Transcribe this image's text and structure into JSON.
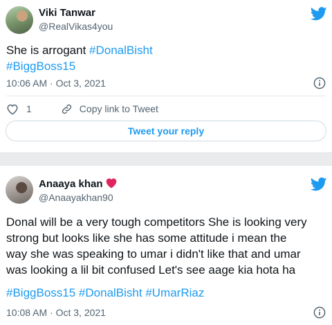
{
  "tweet1": {
    "name": "Viki Tanwar",
    "handle": "@RealVikas4you",
    "text": "She is arrogant ",
    "hashtags": [
      "#DonalBisht",
      "#BiggBoss15"
    ],
    "timestamp": "10:06 AM · Oct 3, 2021",
    "like_count": "1",
    "copy_link_label": "Copy link to Tweet",
    "reply_button_label": "Tweet your reply",
    "icons": [
      "twitter-bird-icon",
      "info-icon",
      "heart-icon",
      "link-icon"
    ]
  },
  "tweet2": {
    "name": "Anaaya khan",
    "name_emoji": "red-heart",
    "handle": "@Anaayakhan90",
    "text_lines": [
      "Donal will be a very tough competitors She is looking very",
      "strong but looks like she has some attitude i mean the",
      "way she was speaking to umar i didn't like that and umar",
      "was looking a lil bit confused Let's see aage kia hota ha"
    ],
    "hashtags": [
      "#BiggBoss15",
      "#DonalBisht",
      "#UmarRiaz"
    ],
    "timestamp": "10:08 AM · Oct 3, 2021",
    "icons": [
      "twitter-bird-icon",
      "info-icon"
    ]
  },
  "colors": {
    "link": "#1d9bf0",
    "text": "#0f1419",
    "muted": "#536471",
    "heart_emoji": "#e0245e",
    "separator": "#e9ebed"
  }
}
